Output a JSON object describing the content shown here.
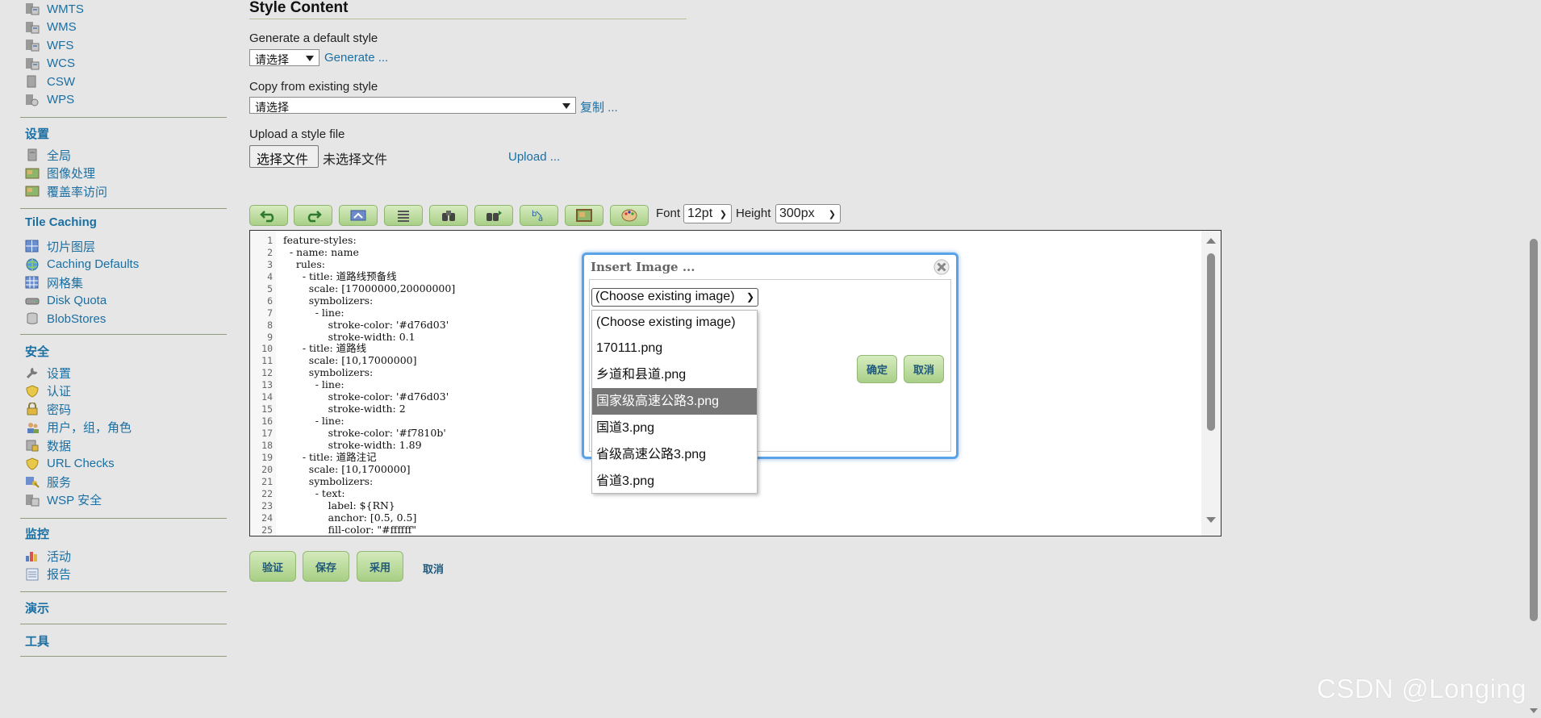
{
  "sidebar": {
    "services": [
      {
        "label": "WMTS",
        "icon": "service-icon"
      },
      {
        "label": "WMS",
        "icon": "service-icon"
      },
      {
        "label": "WFS",
        "icon": "service-icon"
      },
      {
        "label": "WCS",
        "icon": "service-icon"
      },
      {
        "label": "CSW",
        "icon": "service-icon"
      },
      {
        "label": "WPS",
        "icon": "service-icon"
      }
    ],
    "settings_heading": "设置",
    "settings": [
      {
        "label": "全局",
        "icon": "server-icon"
      },
      {
        "label": "图像处理",
        "icon": "image-icon"
      },
      {
        "label": "覆盖率访问",
        "icon": "image-icon"
      }
    ],
    "tile_heading": "Tile Caching",
    "tile": [
      {
        "label": "切片图层",
        "icon": "grid-icon"
      },
      {
        "label": "Caching Defaults",
        "icon": "globe-icon"
      },
      {
        "label": "网格集",
        "icon": "grid-icon"
      },
      {
        "label": "Disk Quota",
        "icon": "disk-icon"
      },
      {
        "label": "BlobStores",
        "icon": "database-icon"
      }
    ],
    "security_heading": "安全",
    "security": [
      {
        "label": "设置",
        "icon": "wrench-icon"
      },
      {
        "label": "认证",
        "icon": "shield-icon"
      },
      {
        "label": "密码",
        "icon": "lock-icon"
      },
      {
        "label": "用户，组，角色",
        "icon": "users-icon"
      },
      {
        "label": "数据",
        "icon": "data-lock-icon"
      },
      {
        "label": "URL Checks",
        "icon": "shield-icon"
      },
      {
        "label": "服务",
        "icon": "key-icon"
      },
      {
        "label": "WSP 安全",
        "icon": "server-icon"
      }
    ],
    "monitor_heading": "监控",
    "monitor": [
      {
        "label": "活动",
        "icon": "bar-chart-icon"
      },
      {
        "label": "报告",
        "icon": "report-icon"
      }
    ],
    "demo_heading": "演示",
    "tools_heading": "工具"
  },
  "style_content": {
    "title": "Style Content",
    "generate_label": "Generate a default style",
    "generate_select": "请选择",
    "generate_link": "Generate ...",
    "copy_label": "Copy from existing style",
    "copy_select": "请选择",
    "copy_link": "复制 ...",
    "upload_label": "Upload a style file",
    "file_button": "选择文件",
    "file_status": "未选择文件",
    "upload_link": "Upload ..."
  },
  "toolbar": {
    "font_label": "Font",
    "font_value": "12pt",
    "height_label": "Height",
    "height_value": "300px"
  },
  "editor": {
    "line_numbers": [
      "1",
      "2",
      "3",
      "4",
      "5",
      "6",
      "7",
      "8",
      "9",
      "10",
      "11",
      "12",
      "13",
      "14",
      "15",
      "16",
      "17",
      "18",
      "19",
      "20",
      "21",
      "22",
      "23",
      "24",
      "25"
    ],
    "lines": [
      "feature-styles:",
      "  - name: name",
      "    rules:",
      "      - title: 道路线预备线",
      "        scale: [17000000,20000000]",
      "        symbolizers:",
      "          - line:",
      "              stroke-color: '#d76d03'",
      "              stroke-width: 0.1",
      "      - title: 道路线",
      "        scale: [10,17000000]",
      "        symbolizers:",
      "          - line:",
      "              stroke-color: '#d76d03'",
      "              stroke-width: 2",
      "          - line:",
      "              stroke-color: '#f7810b'",
      "              stroke-width: 1.89",
      "      - title: 道路注记",
      "        scale: [10,1700000]",
      "        symbolizers:",
      "          - text:",
      "              label: ${RN}",
      "              anchor: [0.5, 0.5]",
      "              fill-color: \"#ffffff\""
    ]
  },
  "actions": {
    "validate": "验证",
    "save": "保存",
    "apply": "采用",
    "cancel": "取消"
  },
  "dialog": {
    "title": "Insert Image ...",
    "select_value": "(Choose existing image)",
    "ok": "确定",
    "cancel": "取消",
    "options": [
      "(Choose existing image)",
      "170111.png",
      "乡道和县道.png",
      "国家级高速公路3.png",
      "国道3.png",
      "省级高速公路3.png",
      "省道3.png"
    ],
    "highlighted_option": "国家级高速公路3.png"
  },
  "watermark": "CSDN @Longing"
}
